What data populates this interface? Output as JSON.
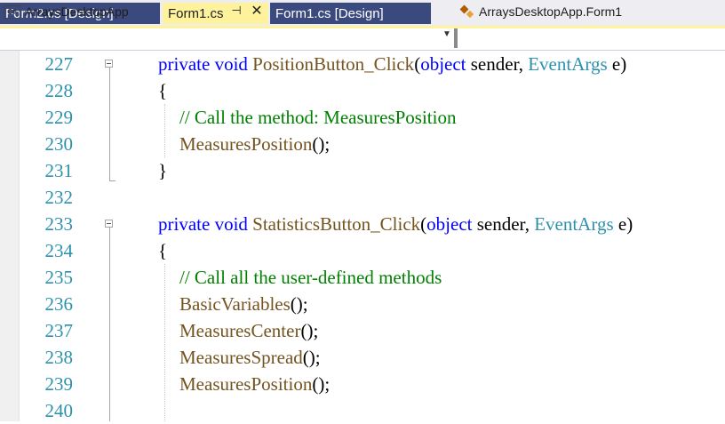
{
  "tabs": [
    {
      "label": "Form2.cs [Design]",
      "active": false
    },
    {
      "label": "Form1.cs",
      "active": true
    },
    {
      "label": "Form1.cs [Design]",
      "active": false
    }
  ],
  "tab_icons": {
    "pin": "pin-icon",
    "close": "close-icon"
  },
  "nav": {
    "project_label": "ArraysDesktopApp",
    "project_icon": "csharp-project-icon",
    "class_label": "ArraysDesktopApp.Form1",
    "class_icon": "class-icon"
  },
  "colors": {
    "active_tab": "#fff29d",
    "inactive_tab": "#3b4a7e",
    "keyword": "#0000ff",
    "type": "#2b91af",
    "method": "#74531f",
    "comment": "#008000",
    "line_number": "#2b91af"
  },
  "lines": [
    {
      "num": "227",
      "indent": 0,
      "tokens": [
        {
          "t": "kw",
          "v": "private"
        },
        {
          "t": "pl",
          "v": " "
        },
        {
          "t": "kw",
          "v": "void"
        },
        {
          "t": "pl",
          "v": " "
        },
        {
          "t": "fn",
          "v": "PositionButton_Click"
        },
        {
          "t": "pl",
          "v": "("
        },
        {
          "t": "kw",
          "v": "object"
        },
        {
          "t": "pl",
          "v": " sender, "
        },
        {
          "t": "ty",
          "v": "EventArgs"
        },
        {
          "t": "pl",
          "v": " e)"
        }
      ]
    },
    {
      "num": "228",
      "indent": 0,
      "tokens": [
        {
          "t": "pl",
          "v": "{"
        }
      ]
    },
    {
      "num": "229",
      "indent": 1,
      "tokens": [
        {
          "t": "cm",
          "v": "// Call the method: MeasuresPosition"
        }
      ]
    },
    {
      "num": "230",
      "indent": 1,
      "tokens": [
        {
          "t": "fn",
          "v": "MeasuresPosition"
        },
        {
          "t": "pl",
          "v": "();"
        }
      ]
    },
    {
      "num": "231",
      "indent": 0,
      "tokens": [
        {
          "t": "pl",
          "v": "}"
        }
      ]
    },
    {
      "num": "232",
      "indent": 0,
      "tokens": []
    },
    {
      "num": "233",
      "indent": 0,
      "tokens": [
        {
          "t": "kw",
          "v": "private"
        },
        {
          "t": "pl",
          "v": " "
        },
        {
          "t": "kw",
          "v": "void"
        },
        {
          "t": "pl",
          "v": " "
        },
        {
          "t": "fn",
          "v": "StatisticsButton_Click"
        },
        {
          "t": "pl",
          "v": "("
        },
        {
          "t": "kw",
          "v": "object"
        },
        {
          "t": "pl",
          "v": " sender, "
        },
        {
          "t": "ty",
          "v": "EventArgs"
        },
        {
          "t": "pl",
          "v": " e)"
        }
      ]
    },
    {
      "num": "234",
      "indent": 0,
      "tokens": [
        {
          "t": "pl",
          "v": "{"
        }
      ]
    },
    {
      "num": "235",
      "indent": 1,
      "tokens": [
        {
          "t": "cm",
          "v": "// Call all the user-defined methods"
        }
      ]
    },
    {
      "num": "236",
      "indent": 1,
      "tokens": [
        {
          "t": "fn",
          "v": "BasicVariables"
        },
        {
          "t": "pl",
          "v": "();"
        }
      ]
    },
    {
      "num": "237",
      "indent": 1,
      "tokens": [
        {
          "t": "fn",
          "v": "MeasuresCenter"
        },
        {
          "t": "pl",
          "v": "();"
        }
      ]
    },
    {
      "num": "238",
      "indent": 1,
      "tokens": [
        {
          "t": "fn",
          "v": "MeasuresSpread"
        },
        {
          "t": "pl",
          "v": "();"
        }
      ]
    },
    {
      "num": "239",
      "indent": 1,
      "tokens": [
        {
          "t": "fn",
          "v": "MeasuresPosition"
        },
        {
          "t": "pl",
          "v": "();"
        }
      ]
    },
    {
      "num": "240",
      "indent": 0,
      "tokens": []
    }
  ]
}
